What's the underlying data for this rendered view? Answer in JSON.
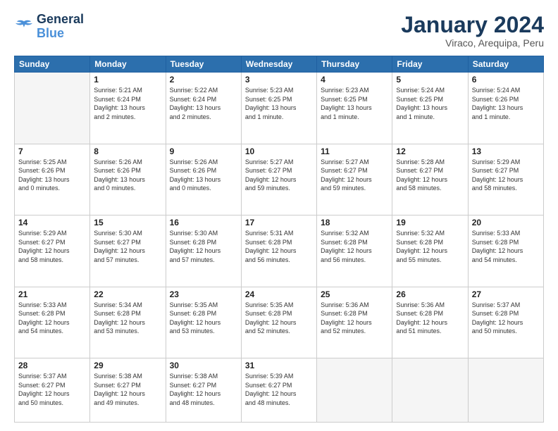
{
  "logo": {
    "line1": "General",
    "line2": "Blue"
  },
  "title": "January 2024",
  "subtitle": "Viraco, Arequipa, Peru",
  "weekdays": [
    "Sunday",
    "Monday",
    "Tuesday",
    "Wednesday",
    "Thursday",
    "Friday",
    "Saturday"
  ],
  "weeks": [
    [
      {
        "day": "",
        "info": ""
      },
      {
        "day": "1",
        "info": "Sunrise: 5:21 AM\nSunset: 6:24 PM\nDaylight: 13 hours\nand 2 minutes."
      },
      {
        "day": "2",
        "info": "Sunrise: 5:22 AM\nSunset: 6:24 PM\nDaylight: 13 hours\nand 2 minutes."
      },
      {
        "day": "3",
        "info": "Sunrise: 5:23 AM\nSunset: 6:25 PM\nDaylight: 13 hours\nand 1 minute."
      },
      {
        "day": "4",
        "info": "Sunrise: 5:23 AM\nSunset: 6:25 PM\nDaylight: 13 hours\nand 1 minute."
      },
      {
        "day": "5",
        "info": "Sunrise: 5:24 AM\nSunset: 6:25 PM\nDaylight: 13 hours\nand 1 minute."
      },
      {
        "day": "6",
        "info": "Sunrise: 5:24 AM\nSunset: 6:26 PM\nDaylight: 13 hours\nand 1 minute."
      }
    ],
    [
      {
        "day": "7",
        "info": "Sunrise: 5:25 AM\nSunset: 6:26 PM\nDaylight: 13 hours\nand 0 minutes."
      },
      {
        "day": "8",
        "info": "Sunrise: 5:26 AM\nSunset: 6:26 PM\nDaylight: 13 hours\nand 0 minutes."
      },
      {
        "day": "9",
        "info": "Sunrise: 5:26 AM\nSunset: 6:26 PM\nDaylight: 13 hours\nand 0 minutes."
      },
      {
        "day": "10",
        "info": "Sunrise: 5:27 AM\nSunset: 6:27 PM\nDaylight: 12 hours\nand 59 minutes."
      },
      {
        "day": "11",
        "info": "Sunrise: 5:27 AM\nSunset: 6:27 PM\nDaylight: 12 hours\nand 59 minutes."
      },
      {
        "day": "12",
        "info": "Sunrise: 5:28 AM\nSunset: 6:27 PM\nDaylight: 12 hours\nand 58 minutes."
      },
      {
        "day": "13",
        "info": "Sunrise: 5:29 AM\nSunset: 6:27 PM\nDaylight: 12 hours\nand 58 minutes."
      }
    ],
    [
      {
        "day": "14",
        "info": "Sunrise: 5:29 AM\nSunset: 6:27 PM\nDaylight: 12 hours\nand 58 minutes."
      },
      {
        "day": "15",
        "info": "Sunrise: 5:30 AM\nSunset: 6:27 PM\nDaylight: 12 hours\nand 57 minutes."
      },
      {
        "day": "16",
        "info": "Sunrise: 5:30 AM\nSunset: 6:28 PM\nDaylight: 12 hours\nand 57 minutes."
      },
      {
        "day": "17",
        "info": "Sunrise: 5:31 AM\nSunset: 6:28 PM\nDaylight: 12 hours\nand 56 minutes."
      },
      {
        "day": "18",
        "info": "Sunrise: 5:32 AM\nSunset: 6:28 PM\nDaylight: 12 hours\nand 56 minutes."
      },
      {
        "day": "19",
        "info": "Sunrise: 5:32 AM\nSunset: 6:28 PM\nDaylight: 12 hours\nand 55 minutes."
      },
      {
        "day": "20",
        "info": "Sunrise: 5:33 AM\nSunset: 6:28 PM\nDaylight: 12 hours\nand 54 minutes."
      }
    ],
    [
      {
        "day": "21",
        "info": "Sunrise: 5:33 AM\nSunset: 6:28 PM\nDaylight: 12 hours\nand 54 minutes."
      },
      {
        "day": "22",
        "info": "Sunrise: 5:34 AM\nSunset: 6:28 PM\nDaylight: 12 hours\nand 53 minutes."
      },
      {
        "day": "23",
        "info": "Sunrise: 5:35 AM\nSunset: 6:28 PM\nDaylight: 12 hours\nand 53 minutes."
      },
      {
        "day": "24",
        "info": "Sunrise: 5:35 AM\nSunset: 6:28 PM\nDaylight: 12 hours\nand 52 minutes."
      },
      {
        "day": "25",
        "info": "Sunrise: 5:36 AM\nSunset: 6:28 PM\nDaylight: 12 hours\nand 52 minutes."
      },
      {
        "day": "26",
        "info": "Sunrise: 5:36 AM\nSunset: 6:28 PM\nDaylight: 12 hours\nand 51 minutes."
      },
      {
        "day": "27",
        "info": "Sunrise: 5:37 AM\nSunset: 6:28 PM\nDaylight: 12 hours\nand 50 minutes."
      }
    ],
    [
      {
        "day": "28",
        "info": "Sunrise: 5:37 AM\nSunset: 6:27 PM\nDaylight: 12 hours\nand 50 minutes."
      },
      {
        "day": "29",
        "info": "Sunrise: 5:38 AM\nSunset: 6:27 PM\nDaylight: 12 hours\nand 49 minutes."
      },
      {
        "day": "30",
        "info": "Sunrise: 5:38 AM\nSunset: 6:27 PM\nDaylight: 12 hours\nand 48 minutes."
      },
      {
        "day": "31",
        "info": "Sunrise: 5:39 AM\nSunset: 6:27 PM\nDaylight: 12 hours\nand 48 minutes."
      },
      {
        "day": "",
        "info": ""
      },
      {
        "day": "",
        "info": ""
      },
      {
        "day": "",
        "info": ""
      }
    ]
  ]
}
